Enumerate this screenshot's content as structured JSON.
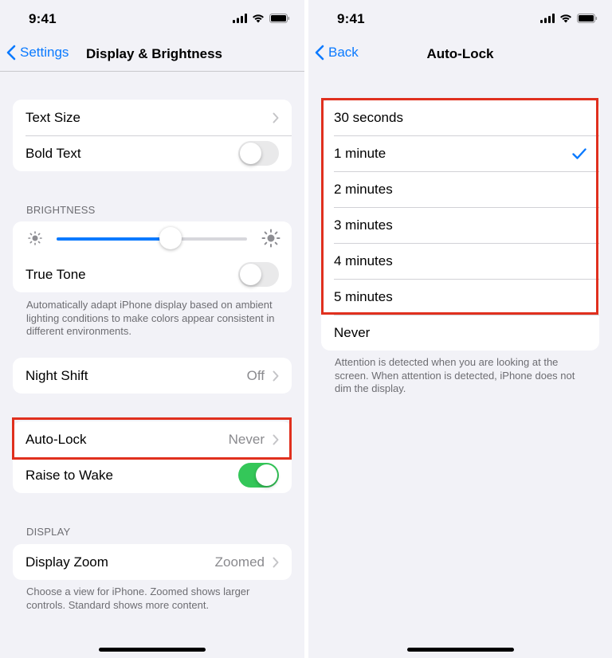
{
  "left": {
    "status": {
      "time": "9:41"
    },
    "nav": {
      "back_label": "Settings",
      "title": "Display & Brightness"
    },
    "group1": [
      {
        "label": "Text Size"
      },
      {
        "label": "Bold Text",
        "toggle": false
      }
    ],
    "brightness": {
      "header": "BRIGHTNESS",
      "level": 0.6,
      "true_tone_label": "True Tone",
      "true_tone": false,
      "footer": "Automatically adapt iPhone display based on ambient lighting conditions to make colors appear consistent in different environments."
    },
    "night_shift": {
      "label": "Night Shift",
      "value": "Off"
    },
    "auto_lock": {
      "label": "Auto-Lock",
      "value": "Never"
    },
    "raise_to_wake": {
      "label": "Raise to Wake",
      "toggle": true
    },
    "display": {
      "header": "DISPLAY",
      "zoom_label": "Display Zoom",
      "zoom_value": "Zoomed",
      "footer": "Choose a view for iPhone. Zoomed shows larger controls. Standard shows more content."
    }
  },
  "right": {
    "status": {
      "time": "9:41"
    },
    "nav": {
      "back_label": "Back",
      "title": "Auto-Lock"
    },
    "options": [
      {
        "label": "30 seconds",
        "selected": false
      },
      {
        "label": "1 minute",
        "selected": true
      },
      {
        "label": "2 minutes",
        "selected": false
      },
      {
        "label": "3 minutes",
        "selected": false
      },
      {
        "label": "4 minutes",
        "selected": false
      },
      {
        "label": "5 minutes",
        "selected": false
      },
      {
        "label": "Never",
        "selected": false
      }
    ],
    "footer": "Attention is detected when you are looking at the screen. When attention is detected, iPhone does not dim the display."
  },
  "colors": {
    "accent": "#0a7aff",
    "toggle_on": "#34c759",
    "highlight": "#e0301e",
    "background": "#f2f2f7"
  },
  "icons": [
    "cellular-signal-icon",
    "wifi-icon",
    "battery-icon",
    "chevron-left-icon",
    "chevron-right-icon",
    "sun-small-icon",
    "sun-large-icon",
    "checkmark-icon"
  ]
}
